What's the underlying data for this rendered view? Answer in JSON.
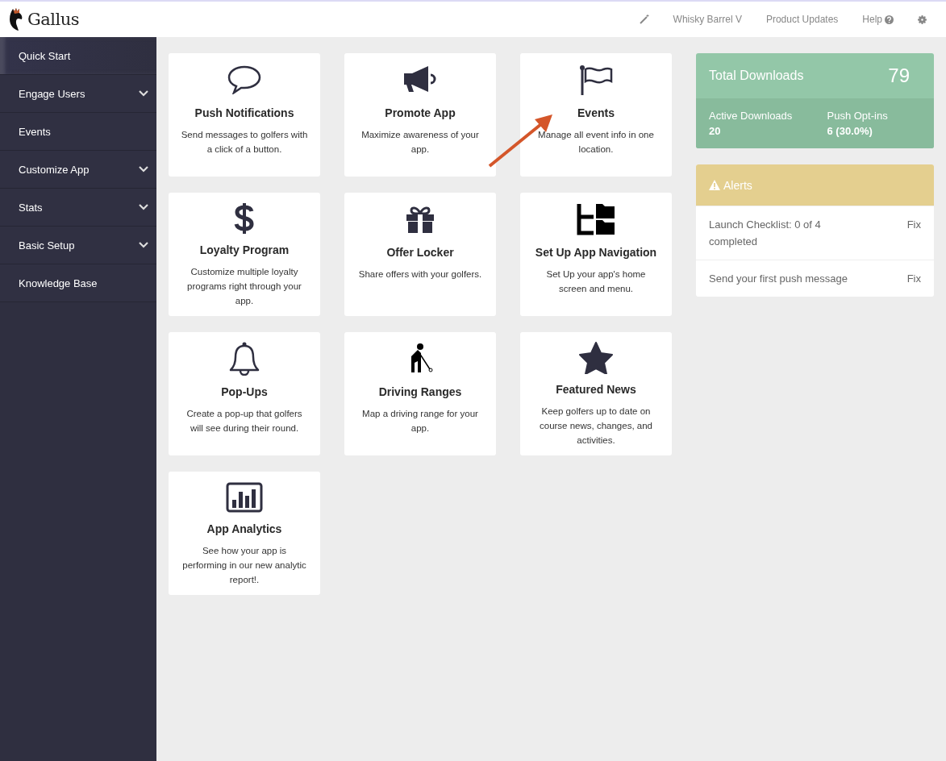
{
  "header": {
    "logo": "Gallus",
    "nav": [
      {
        "kind": "icon"
      },
      {
        "kind": "text",
        "label": "Whisky Barrel V"
      },
      {
        "kind": "text",
        "label": "Product Updates"
      },
      {
        "kind": "help",
        "label": "Help"
      },
      {
        "kind": "gear"
      }
    ]
  },
  "sidebar": {
    "items": [
      {
        "label": "Quick Start",
        "selected": true,
        "has_submenu": false
      },
      {
        "label": "Engage Users",
        "selected": false,
        "has_submenu": true
      },
      {
        "label": "Events",
        "selected": false,
        "has_submenu": false
      },
      {
        "label": "Customize App",
        "selected": false,
        "has_submenu": true
      },
      {
        "label": "Stats",
        "selected": false,
        "has_submenu": true
      },
      {
        "label": "Basic Setup",
        "selected": false,
        "has_submenu": true
      },
      {
        "label": "Knowledge Base",
        "selected": false,
        "has_submenu": false
      }
    ]
  },
  "cards": [
    {
      "title": "Push Notifications",
      "text": "Send messages to golfers with a click of a button."
    },
    {
      "title": "Promote App",
      "text": "Maximize awareness of your app."
    },
    {
      "title": "Events",
      "text": "Manage all event info in one location."
    },
    {
      "title": "Loyalty Program",
      "text": "Customize multiple loyalty programs right through your app."
    },
    {
      "title": "Offer Locker",
      "text": "Share offers with your golfers."
    },
    {
      "title": "Set Up App Navigation",
      "text": "Set Up your app's home screen and menu."
    },
    {
      "title": "Pop-Ups",
      "text": "Create a pop-up that golfers will see during their round."
    },
    {
      "title": "Driving Ranges",
      "text": "Map a driving range for your app."
    },
    {
      "title": "Featured News",
      "text": "Keep golfers up to date on course news, changes, and activities."
    },
    {
      "title": "App Analytics",
      "text": "See how your app is performing in our new analytic report!."
    }
  ],
  "stats": {
    "total_label": "Total Downloads",
    "total_value": "79",
    "items": [
      {
        "label": "Active Downloads",
        "value": "20"
      },
      {
        "label": "Push Opt-ins",
        "value": "6 (30.0%)"
      }
    ]
  },
  "alerts": {
    "title": "Alerts",
    "items": [
      {
        "text": "Launch Checklist: 0 of 4 completed",
        "action": "Fix"
      },
      {
        "text": "Send your first push message",
        "action": "Fix"
      }
    ]
  }
}
